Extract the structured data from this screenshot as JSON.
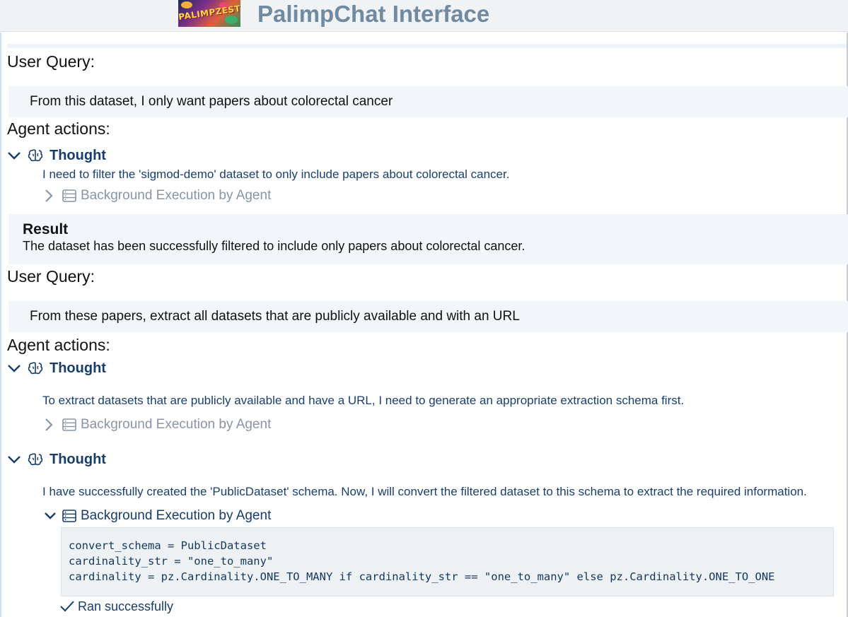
{
  "header": {
    "logo_text": "PALIMPZEST",
    "app_title": "PalimpChat Interface"
  },
  "conversation": [
    {
      "user_query_label": "User Query:",
      "query": "From this dataset, I only want papers about colorectal cancer",
      "agent_actions_label": "Agent actions:",
      "thoughts": [
        {
          "label": "Thought",
          "text": "I need to filter the 'sigmod-demo' dataset to only include papers about colorectal cancer.",
          "background_label": "Background Execution by Agent",
          "background_expanded": false
        }
      ],
      "result": {
        "title": "Result",
        "text": "The dataset has been successfully filtered to include only papers about colorectal cancer."
      }
    },
    {
      "user_query_label": "User Query:",
      "query": "From these papers, extract all datasets that are publicly available and with an URL",
      "agent_actions_label": "Agent actions:",
      "thoughts": [
        {
          "label": "Thought",
          "text": "To extract datasets that are publicly available and have a URL, I need to generate an appropriate extraction schema first.",
          "background_label": "Background Execution by Agent",
          "background_expanded": false
        },
        {
          "label": "Thought",
          "text": "I have successfully created the 'PublicDataset' schema. Now, I will convert the filtered dataset to this schema to extract the required information.",
          "background_label": "Background Execution by Agent",
          "background_expanded": true,
          "code_lines": [
            "convert_schema = PublicDataset",
            "cardinality_str = \"one_to_many\"",
            "cardinality = pz.Cardinality.ONE_TO_MANY if cardinality_str == \"one_to_many\" else pz.Cardinality.ONE_TO_ONE"
          ],
          "status": "Ran successfully"
        }
      ]
    }
  ],
  "icons": {
    "chevron_expanded": "chevron-down-icon",
    "chevron_collapsed": "chevron-right-icon",
    "thought": "brain-icon",
    "background": "server-stack-icon",
    "status": "check-icon"
  },
  "colors": {
    "accent": "#163d6b",
    "muted": "#8795a6",
    "panel": "#f2f6fa",
    "title": "#6f8aa3"
  }
}
